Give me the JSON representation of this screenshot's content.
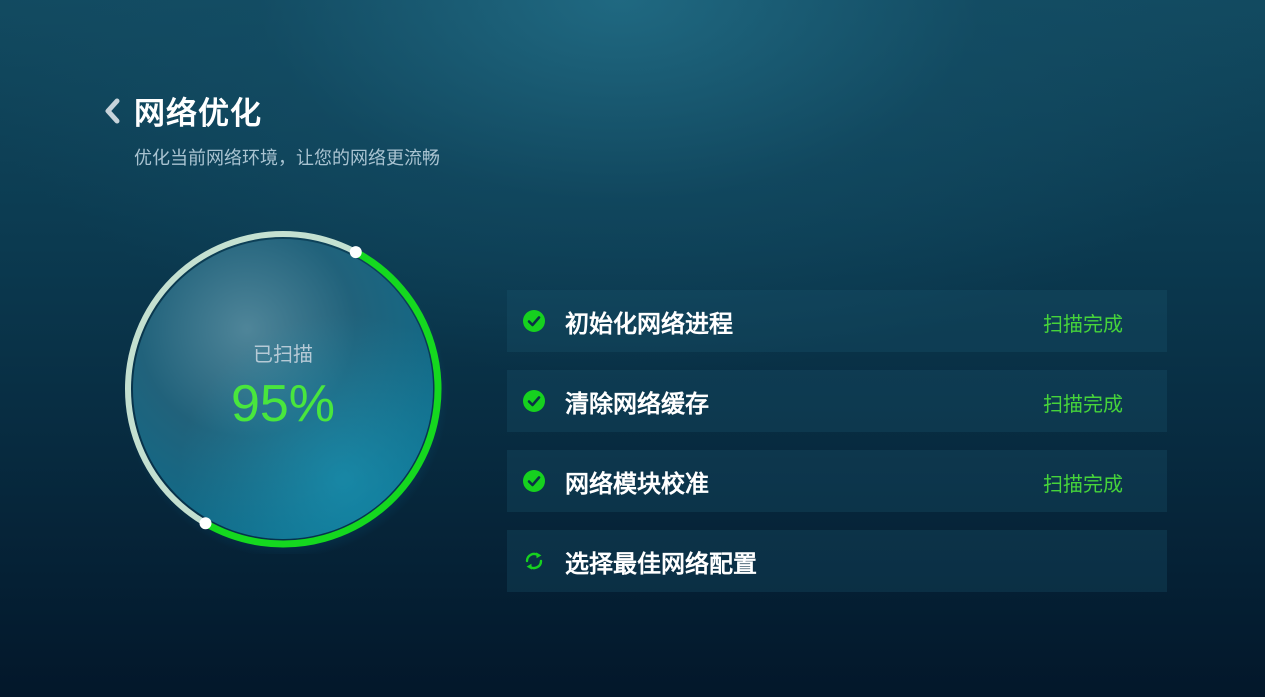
{
  "header": {
    "title": "网络优化",
    "subtitle": "优化当前网络环境，让您的网络更流畅"
  },
  "gauge": {
    "label": "已扫描",
    "value_text": "95%",
    "progress": 0.95
  },
  "tasks": [
    {
      "label": "初始化网络进程",
      "status": "扫描完成",
      "icon": "check-circle-icon"
    },
    {
      "label": "清除网络缓存",
      "status": "扫描完成",
      "icon": "check-circle-icon"
    },
    {
      "label": "网络模块校准",
      "status": "扫描完成",
      "icon": "check-circle-icon"
    },
    {
      "label": "选择最佳网络配置",
      "status": "",
      "icon": "refresh-icon"
    }
  ],
  "colors": {
    "accent_green": "#46d43a",
    "ring_green": "#15d81f",
    "background_top": "#124a60",
    "background_bottom": "#03172a"
  }
}
